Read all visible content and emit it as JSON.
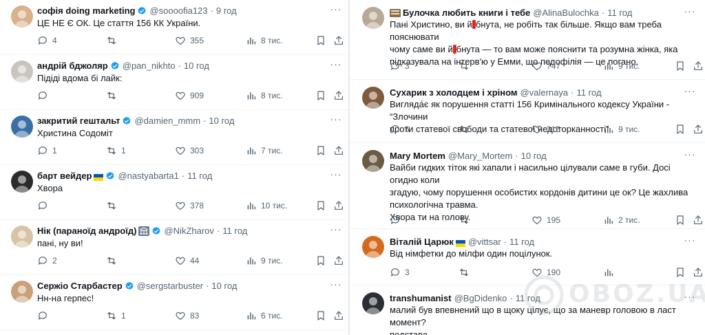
{
  "left_tweets": [
    {
      "name": "софія doing marketing",
      "verified": true,
      "flag": false,
      "badge": false,
      "handle": "@soooofia123",
      "time": "9 год",
      "text": "ЦЕ НЕ Є ОК. Це стаття 156 КК України.",
      "replies": "4",
      "retweets": "",
      "likes": "355",
      "views": "8 тис.",
      "avatar_color": "#d9b18a"
    },
    {
      "name": "андрій бджоляр",
      "verified": true,
      "flag": false,
      "badge": false,
      "handle": "@pan_nikhto",
      "time": "10 год",
      "text": "Підіді вдома бі лайк:",
      "replies": "",
      "retweets": "",
      "likes": "909",
      "views": "8 тис.",
      "avatar_color": "#c9c4bd"
    },
    {
      "name": "закритий гештальт",
      "verified": true,
      "flag": false,
      "badge": false,
      "handle": "@damien_mmm",
      "time": "10 год",
      "text": "Христина Содоміт",
      "replies": "1",
      "retweets": "1",
      "likes": "303",
      "views": "7 тис.",
      "avatar_color": "#3a6ea5"
    },
    {
      "name": "барт вейдер",
      "verified": true,
      "flag": true,
      "badge": false,
      "handle": "@nastyabarta1",
      "time": "11 год",
      "text": "Хвора",
      "replies": "",
      "retweets": "",
      "likes": "378",
      "views": "10 тис.",
      "avatar_color": "#2b2b2b"
    },
    {
      "name": "Нік (параноїд андроїд)",
      "verified": true,
      "flag": false,
      "badge": true,
      "handle": "@NikZharov",
      "time": "11 год",
      "text": "пані, ну ви!",
      "replies": "2",
      "retweets": "",
      "likes": "44",
      "views": "9 тис.",
      "avatar_color": "#d8c3a5"
    },
    {
      "name": "Серж­іо Старбастер",
      "verified": true,
      "flag": false,
      "badge": false,
      "handle": "@sergstarbuster",
      "time": "10 год",
      "text": "Нн-на герпес!",
      "replies": "",
      "retweets": "1",
      "likes": "83",
      "views": "6 тис.",
      "avatar_color": "#caa07a"
    }
  ],
  "right_tweets": [
    {
      "name": "Булочка любить книги і тебе",
      "handle": "@AlinaBulochka",
      "time": "11 год",
      "verified": false,
      "flag": false,
      "book": true,
      "text_a": "Пані Христино, ви й",
      "text_b": "бнута, не робіть так більше. Якщо вам треба пояснювати",
      "text_c": "чому саме ви й",
      "text_d": "бнута — то вам може пояснити та розумна жінка, яка",
      "text_e": "підказувала на інтерв'ю у Емми, що педофілія — це погано.",
      "replies": "3",
      "retweets": "",
      "likes": "747",
      "views": "9 тис.",
      "avatar_color": "#b8a896"
    },
    {
      "name": "Сухарик з холодцем і хріном",
      "handle": "@valernaya",
      "time": "11 год",
      "verified": false,
      "flag": false,
      "book": false,
      "text": "Вигляда́є як порушення статті 156 Кримінального кодексу України - “Злочини\nпроти статевої свободи та статевої недоторканності”",
      "replies": "5",
      "retweets": "",
      "likes": "315",
      "views": "9 тис.",
      "avatar_color": "#7f5a3c"
    },
    {
      "name": "Mary Mortem",
      "handle": "@Mary_Mortem",
      "time": "10 год",
      "verified": false,
      "flag": false,
      "book": false,
      "text": "Вайби гидких тіток які хапали і насильно цілували саме в губи. Досі огидно коли\nзгадую, чому порушення особистих кордонів дитини це ок? Це жахлива\nпсихологічна травма.\nХвора ти на голову.",
      "replies": "",
      "retweets": "",
      "likes": "195",
      "views": "2 тис.",
      "avatar_color": "#6b5a44"
    },
    {
      "name": "Віталій Царюк",
      "handle": "@vittsar",
      "time": "11 год",
      "verified": false,
      "flag": true,
      "book": false,
      "text": "Від німфетки до мілфи один поцілунок.",
      "replies": "3",
      "retweets": "",
      "likes": "190",
      "views": "",
      "avatar_color": "#d46a1e"
    },
    {
      "name": "transhumanist",
      "handle": "@BgDidenko",
      "time": "11 год",
      "verified": false,
      "flag": false,
      "book": false,
      "text": "малий був впевнений що в щоку цілує, що за маневр головою в ласт момент?\nподстава...",
      "replies": "",
      "retweets": "",
      "likes": "",
      "views": "",
      "avatar_color": "#2a2f36"
    }
  ],
  "watermark": "OBOZ.UA",
  "colors": {
    "text": "#0f1419",
    "muted": "#536471",
    "verified": "#1d9bf0",
    "divider": "#eff3f4"
  }
}
